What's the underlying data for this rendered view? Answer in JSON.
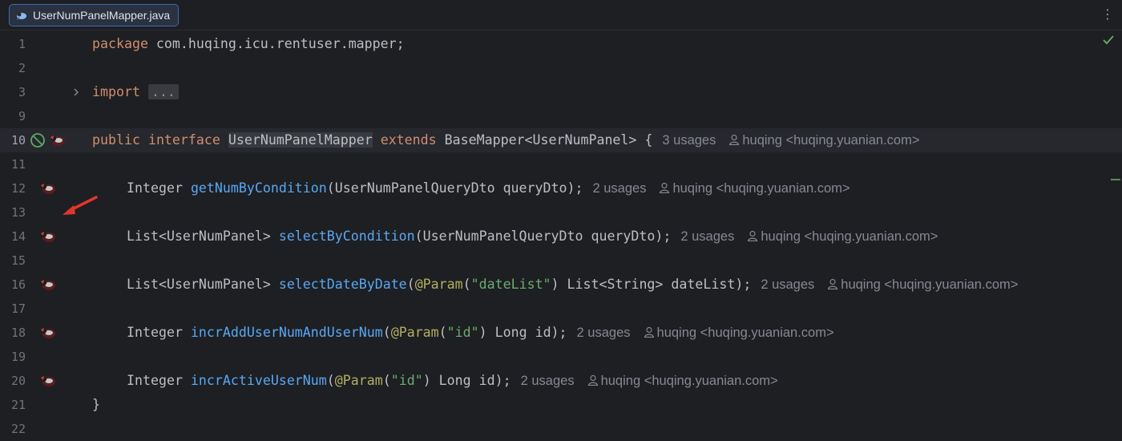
{
  "tab": {
    "filename": "UserNumPanelMapper.java",
    "icon": "mybatis-mapper-icon"
  },
  "tab_menu": {
    "glyph": "⋮"
  },
  "lines": [
    {
      "num": "1"
    },
    {
      "num": "2"
    },
    {
      "num": "3"
    },
    {
      "num": "9"
    },
    {
      "num": "10"
    },
    {
      "num": "11"
    },
    {
      "num": "12"
    },
    {
      "num": "13"
    },
    {
      "num": "14"
    },
    {
      "num": "15"
    },
    {
      "num": "16"
    },
    {
      "num": "17"
    },
    {
      "num": "18"
    },
    {
      "num": "19"
    },
    {
      "num": "20"
    },
    {
      "num": "21"
    },
    {
      "num": "22"
    }
  ],
  "code": {
    "l1": {
      "kw": "package",
      "rest": " com.huqing.icu.rentuser.mapper;"
    },
    "l3": {
      "kw": "import",
      "fold": "..."
    },
    "l10": {
      "kw1": "public",
      "kw2": "interface",
      "name": "UserNumPanelMapper",
      "kw3": "extends",
      "rest": "BaseMapper<UserNumPanel> {",
      "usages": "3 usages",
      "author": "huqing <huqing.yuanian.com>"
    },
    "l12": {
      "type": "Integer",
      "fn": "getNumByCondition",
      "rest": "(UserNumPanelQueryDto queryDto);",
      "usages": "2 usages",
      "author": "huqing <huqing.yuanian.com>"
    },
    "l14": {
      "type": "List<UserNumPanel>",
      "fn": "selectByCondition",
      "rest": "(UserNumPanelQueryDto queryDto);",
      "usages": "2 usages",
      "author": "huqing <huqing.yuanian.com>"
    },
    "l16": {
      "type": "List<UserNumPanel>",
      "fn": "selectDateByDate",
      "p1": "(",
      "ann": "@Param",
      "p2": "(",
      "str": "\"dateList\"",
      "rest": ") List<String> dateList);",
      "usages": "2 usages",
      "author": "huqing <huqing.yuanian.com>"
    },
    "l18": {
      "type": "Integer",
      "fn": "incrAddUserNumAndUserNum",
      "p1": "(",
      "ann": "@Param",
      "p2": "(",
      "str": "\"id\"",
      "rest": ") Long id);",
      "usages": "2 usages",
      "author": "huqing <huqing.yuanian.com>"
    },
    "l20": {
      "type": "Integer",
      "fn": "incrActiveUserNum",
      "p1": "(",
      "ann": "@Param",
      "p2": "(",
      "str": "\"id\"",
      "rest": ") Long id);",
      "usages": "2 usages",
      "author": "huqing <huqing.yuanian.com>"
    },
    "l21": {
      "text": "}"
    }
  },
  "colors": {
    "background": "#1e1f22",
    "keyword": "#cf8e6d",
    "function": "#56a8f5",
    "string": "#6aab73",
    "annotation": "#b3ae60",
    "hint": "#868993",
    "arrow": "#e5352b"
  }
}
